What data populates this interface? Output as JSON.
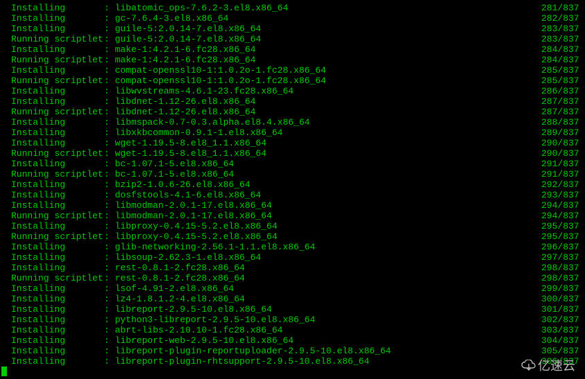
{
  "terminal": {
    "lines": [
      {
        "action": "Installing       ",
        "package": ": libatomic_ops-7.6.2-3.el8.x86_64",
        "counter": "281/837"
      },
      {
        "action": "Installing       ",
        "package": ": gc-7.6.4-3.el8.x86_64",
        "counter": "282/837"
      },
      {
        "action": "Installing       ",
        "package": ": guile-5:2.0.14-7.el8.x86_64",
        "counter": "283/837"
      },
      {
        "action": "Running scriptlet",
        "package": ": guile-5:2.0.14-7.el8.x86_64",
        "counter": "283/837"
      },
      {
        "action": "Installing       ",
        "package": ": make-1:4.2.1-6.fc28.x86_64",
        "counter": "284/837"
      },
      {
        "action": "Running scriptlet",
        "package": ": make-1:4.2.1-6.fc28.x86_64",
        "counter": "284/837"
      },
      {
        "action": "Installing       ",
        "package": ": compat-openssl10-1:1.0.2o-1.fc28.x86_64",
        "counter": "285/837"
      },
      {
        "action": "Running scriptlet",
        "package": ": compat-openssl10-1:1.0.2o-1.fc28.x86_64",
        "counter": "285/837"
      },
      {
        "action": "Installing       ",
        "package": ": libwvstreams-4.6.1-23.fc28.x86_64",
        "counter": "286/837"
      },
      {
        "action": "Installing       ",
        "package": ": libdnet-1.12-26.el8.x86_64",
        "counter": "287/837"
      },
      {
        "action": "Running scriptlet",
        "package": ": libdnet-1.12-26.el8.x86_64",
        "counter": "287/837"
      },
      {
        "action": "Installing       ",
        "package": ": libmspack-0.7-0.3.alpha.el8.4.x86_64",
        "counter": "288/837"
      },
      {
        "action": "Installing       ",
        "package": ": libxkbcommon-0.9.1-1.el8.x86_64",
        "counter": "289/837"
      },
      {
        "action": "Installing       ",
        "package": ": wget-1.19.5-8.el8_1.1.x86_64",
        "counter": "290/837"
      },
      {
        "action": "Running scriptlet",
        "package": ": wget-1.19.5-8.el8_1.1.x86_64",
        "counter": "290/837"
      },
      {
        "action": "Installing       ",
        "package": ": bc-1.07.1-5.el8.x86_64",
        "counter": "291/837"
      },
      {
        "action": "Running scriptlet",
        "package": ": bc-1.07.1-5.el8.x86_64",
        "counter": "291/837"
      },
      {
        "action": "Installing       ",
        "package": ": bzip2-1.0.6-26.el8.x86_64",
        "counter": "292/837"
      },
      {
        "action": "Installing       ",
        "package": ": dosfstools-4.1-6.el8.x86_64",
        "counter": "293/837"
      },
      {
        "action": "Installing       ",
        "package": ": libmodman-2.0.1-17.el8.x86_64",
        "counter": "294/837"
      },
      {
        "action": "Running scriptlet",
        "package": ": libmodman-2.0.1-17.el8.x86_64",
        "counter": "294/837"
      },
      {
        "action": "Installing       ",
        "package": ": libproxy-0.4.15-5.2.el8.x86_64",
        "counter": "295/837"
      },
      {
        "action": "Running scriptlet",
        "package": ": libproxy-0.4.15-5.2.el8.x86_64",
        "counter": "295/837"
      },
      {
        "action": "Installing       ",
        "package": ": glib-networking-2.56.1-1.1.el8.x86_64",
        "counter": "296/837"
      },
      {
        "action": "Installing       ",
        "package": ": libsoup-2.62.3-1.el8.x86_64",
        "counter": "297/837"
      },
      {
        "action": "Installing       ",
        "package": ": rest-0.8.1-2.fc28.x86_64",
        "counter": "298/837"
      },
      {
        "action": "Running scriptlet",
        "package": ": rest-0.8.1-2.fc28.x86_64",
        "counter": "298/837"
      },
      {
        "action": "Installing       ",
        "package": ": lsof-4.91-2.el8.x86_64",
        "counter": "299/837"
      },
      {
        "action": "Installing       ",
        "package": ": lz4-1.8.1.2-4.el8.x86_64",
        "counter": "300/837"
      },
      {
        "action": "Installing       ",
        "package": ": libreport-2.9.5-10.el8.x86_64",
        "counter": "301/837"
      },
      {
        "action": "Installing       ",
        "package": ": python3-libreport-2.9.5-10.el8.x86_64",
        "counter": "302/837"
      },
      {
        "action": "Installing       ",
        "package": ": abrt-libs-2.10.10-1.fc28.x86_64",
        "counter": "303/837"
      },
      {
        "action": "Installing       ",
        "package": ": libreport-web-2.9.5-10.el8.x86_64",
        "counter": "304/837"
      },
      {
        "action": "Installing       ",
        "package": ": libreport-plugin-reportuploader-2.9.5-10.el8.x86_64",
        "counter": "305/837"
      },
      {
        "action": "Installing       ",
        "package": ": libreport-plugin-rhtsupport-2.9.5-10.el8.x86_64",
        "counter": "306/837"
      }
    ]
  },
  "watermark": {
    "text": "亿速云"
  }
}
